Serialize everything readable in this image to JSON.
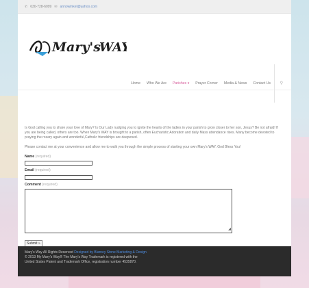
{
  "topbar": {
    "phone": "630-728-6099",
    "email": "annowinkel@yahoo.com"
  },
  "logo": {
    "text": "Mary's WAY"
  },
  "nav": {
    "items": [
      "Home",
      "Who We Are",
      "Parishes",
      "Prayer Corner",
      "Media & News",
      "Contact Us"
    ],
    "parishes_caret": "▾"
  },
  "content": {
    "para1": "Is God calling you to share your love of Mary?  Is Our Lady nudging you to ignite the hearts of the ladies in your parish to grow closer to her son, Jesus?  Be not afraid!  If you are being called, others are too.  When Mary's WAY is brought to a parish, often Eucharistic Adoration and daily Mass attendance rises.  Many become devoted to praying the rosary again and wonderful,Catholic friendships are deepened.",
    "para2": "Please contact me at your convenience and allow me to walk you through the simple process of starting your own Mary's WAY.  God Bless You!"
  },
  "form": {
    "name_label": "Name",
    "email_label": "Email",
    "comment_label": "Comment",
    "required_text": "(required)",
    "submit_label": "Submit »"
  },
  "footer": {
    "prefix": "Mary's Way All Rights Reserved",
    "designer_link": "Designed by Blarney Stone Marketing & Design",
    "suffix": "© 2013 My Mary's Way® The Mary's Way Trademark is registered with the United States Patent and Trademark Office, registration number 4535870."
  },
  "colors": {
    "accent": "#d65b9a",
    "link": "#4e8de0",
    "footer_bg": "#2b2b2b"
  }
}
